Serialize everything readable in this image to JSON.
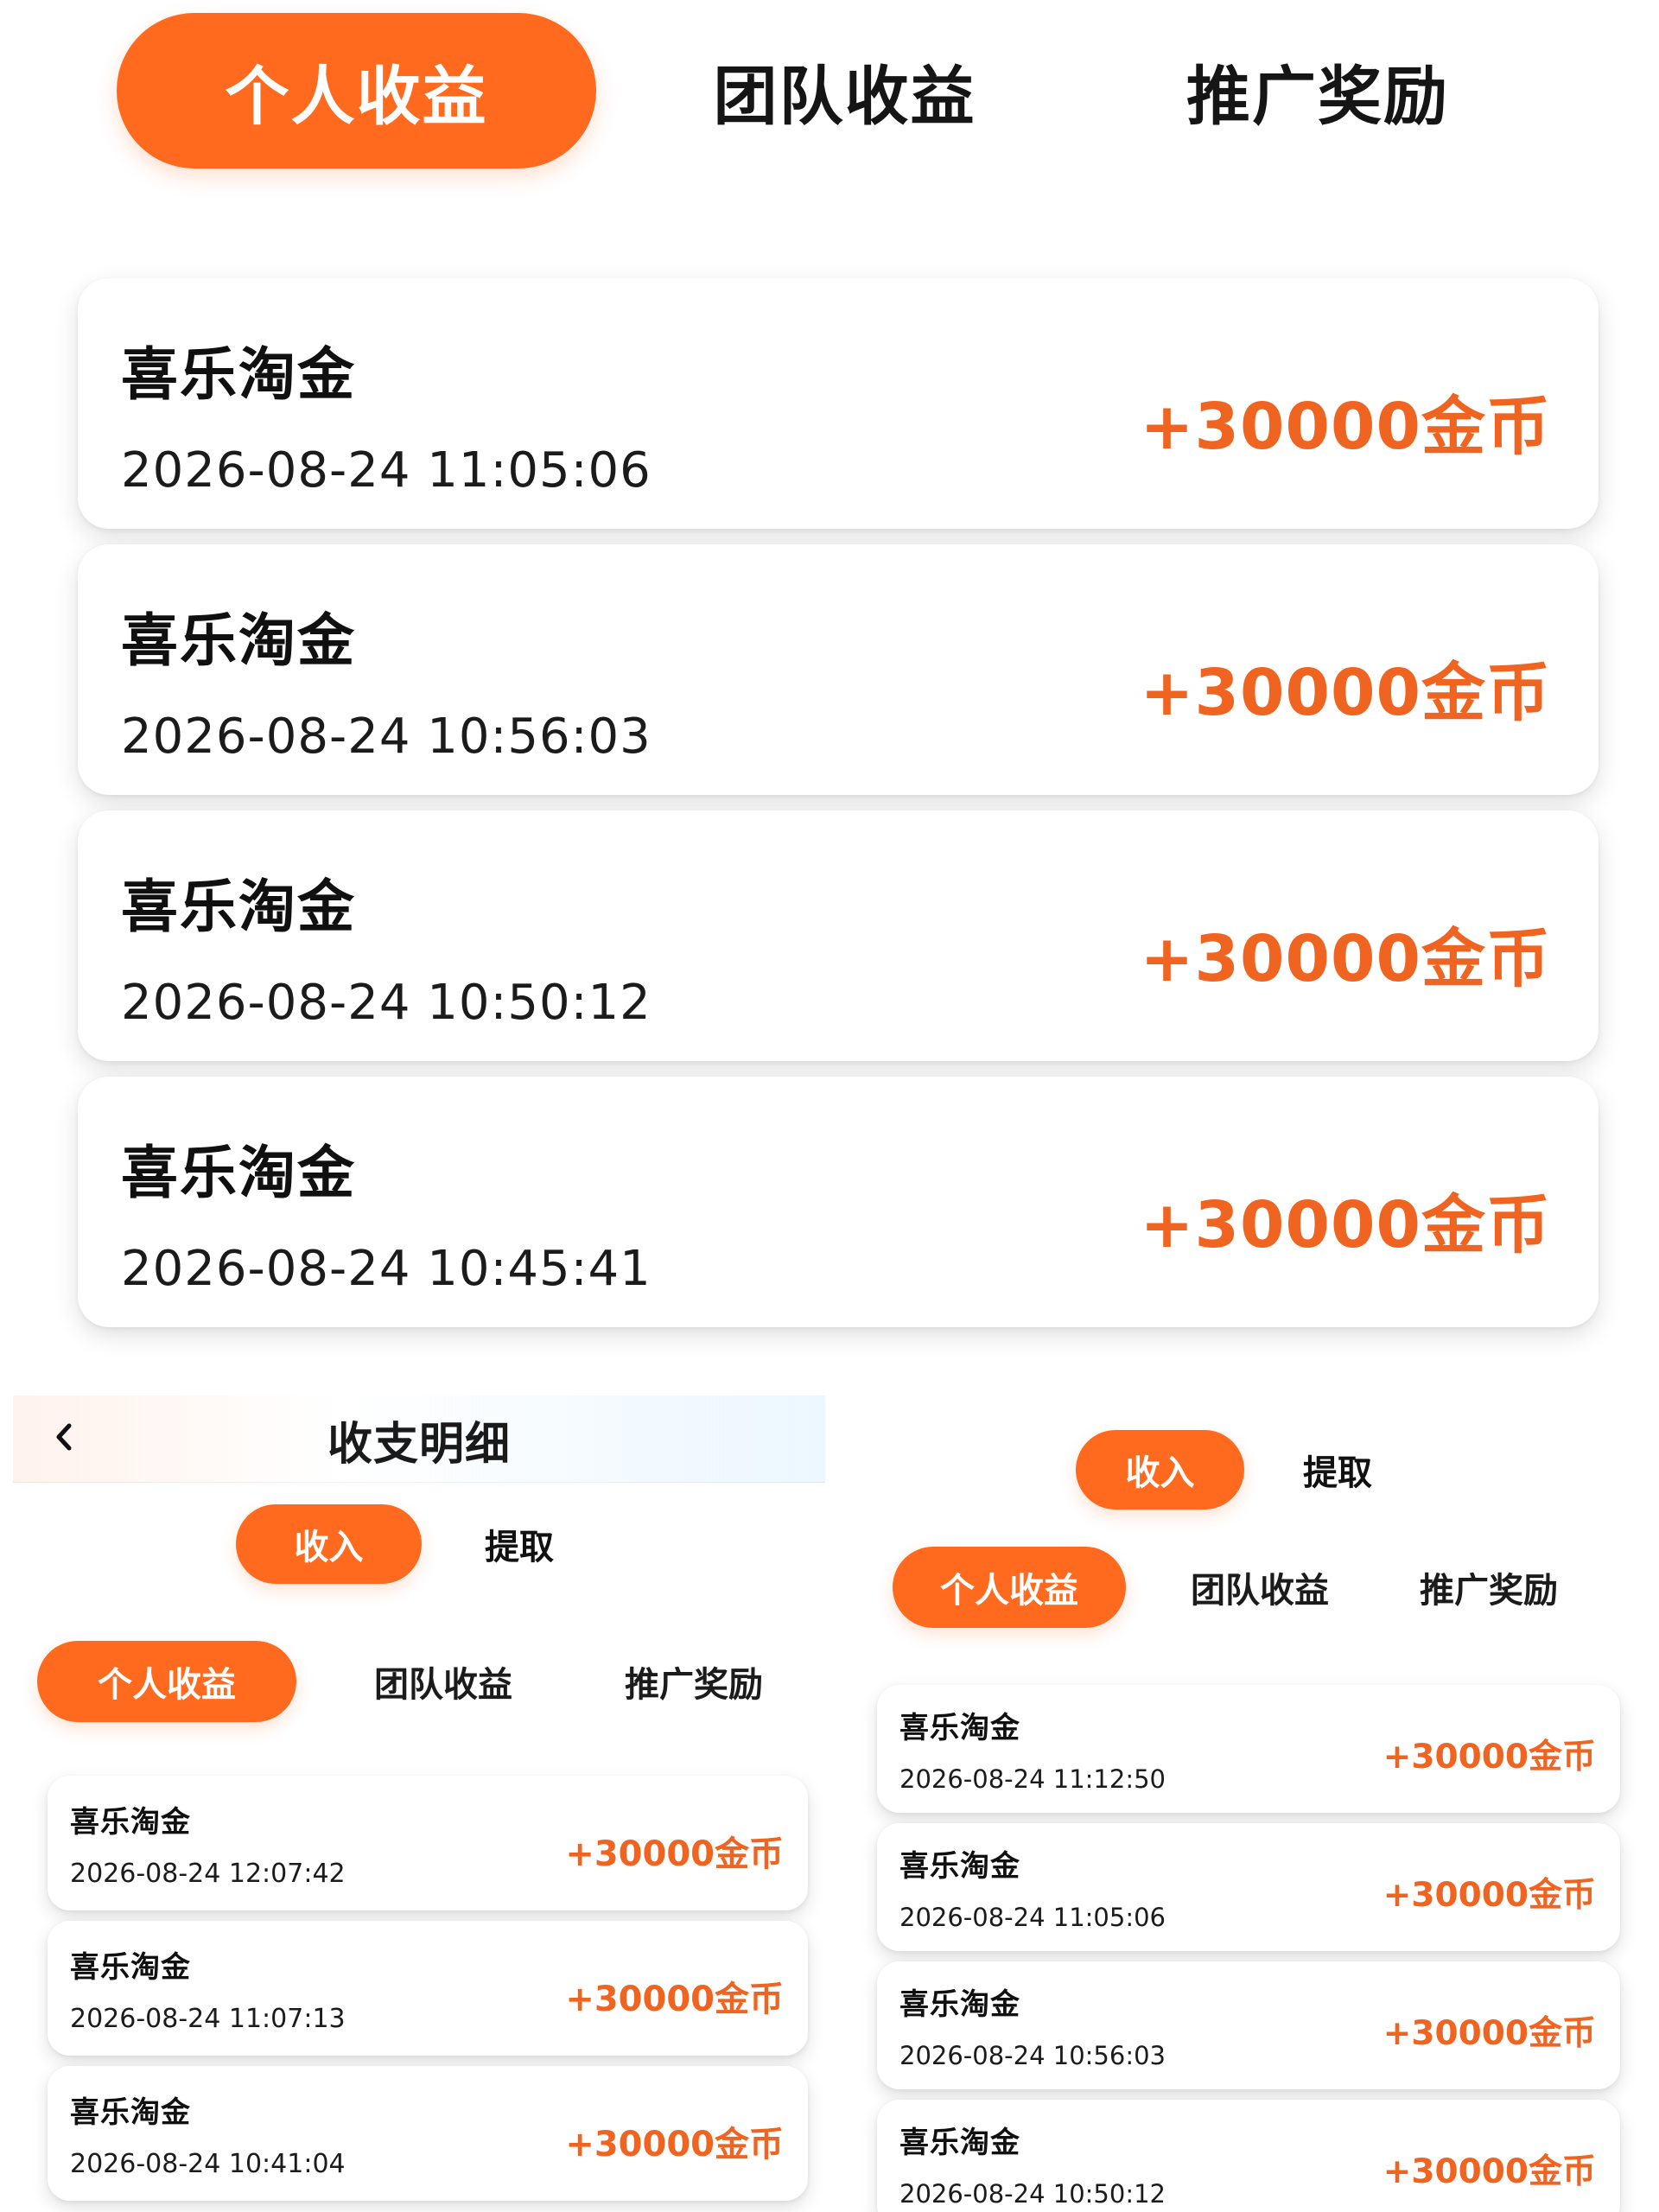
{
  "colors": {
    "accent": "#FF6A1F",
    "amount": "#F06422"
  },
  "top_panel": {
    "tabs": [
      {
        "label": "个人收益",
        "active": true
      },
      {
        "label": "团队收益",
        "active": false
      },
      {
        "label": "推广奖励",
        "active": false
      }
    ],
    "records": [
      {
        "title": "喜乐淘金",
        "time": "2026-08-24 11:05:06",
        "amount": "+30000金币"
      },
      {
        "title": "喜乐淘金",
        "time": "2026-08-24 10:56:03",
        "amount": "+30000金币"
      },
      {
        "title": "喜乐淘金",
        "time": "2026-08-24 10:50:12",
        "amount": "+30000金币"
      },
      {
        "title": "喜乐淘金",
        "time": "2026-08-24 10:45:41",
        "amount": "+30000金币"
      }
    ]
  },
  "bottom_left": {
    "header": {
      "title": "收支明细",
      "back_icon": "chevron-left-icon"
    },
    "toggle": [
      {
        "label": "收入",
        "active": true
      },
      {
        "label": "提取",
        "active": false
      }
    ],
    "tabs": [
      {
        "label": "个人收益",
        "active": true
      },
      {
        "label": "团队收益",
        "active": false
      },
      {
        "label": "推广奖励",
        "active": false
      }
    ],
    "records": [
      {
        "title": "喜乐淘金",
        "time": "2026-08-24 12:07:42",
        "amount": "+30000金币"
      },
      {
        "title": "喜乐淘金",
        "time": "2026-08-24 11:07:13",
        "amount": "+30000金币"
      },
      {
        "title": "喜乐淘金",
        "time": "2026-08-24 10:41:04",
        "amount": "+30000金币"
      }
    ]
  },
  "bottom_right": {
    "toggle": [
      {
        "label": "收入",
        "active": true
      },
      {
        "label": "提取",
        "active": false
      }
    ],
    "tabs": [
      {
        "label": "个人收益",
        "active": true
      },
      {
        "label": "团队收益",
        "active": false
      },
      {
        "label": "推广奖励",
        "active": false
      }
    ],
    "records": [
      {
        "title": "喜乐淘金",
        "time": "2026-08-24 11:12:50",
        "amount": "+30000金币"
      },
      {
        "title": "喜乐淘金",
        "time": "2026-08-24 11:05:06",
        "amount": "+30000金币"
      },
      {
        "title": "喜乐淘金",
        "time": "2026-08-24 10:56:03",
        "amount": "+30000金币"
      },
      {
        "title": "喜乐淘金",
        "time": "2026-08-24 10:50:12",
        "amount": "+30000金币"
      }
    ]
  }
}
